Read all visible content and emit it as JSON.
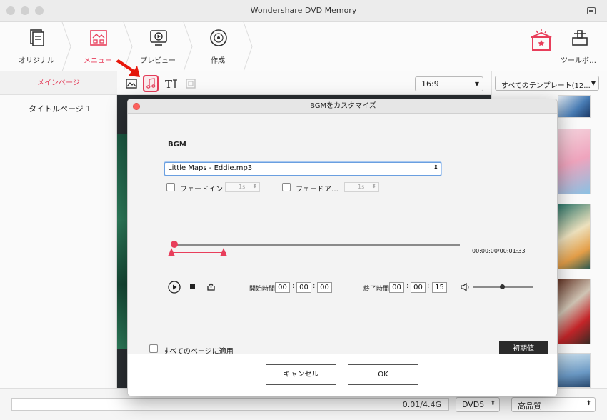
{
  "window": {
    "title": "Wondershare DVD Memory"
  },
  "steps": [
    {
      "label": "オリジナル"
    },
    {
      "label": "メニュー"
    },
    {
      "label": "プレビュー"
    },
    {
      "label": "作成"
    }
  ],
  "toolbox": {
    "label": "ツールボ…"
  },
  "sidebar": {
    "tab": "メインページ",
    "item": "タイトルページ 1"
  },
  "editbar": {
    "ratio": "16:9"
  },
  "templates": {
    "dropdown": "すべてのテンプレート(12..."
  },
  "status": {
    "capacity": "0.01/4.4G",
    "disc": "DVD5",
    "quality": "高品質"
  },
  "dialog": {
    "title": "BGMをカスタマイズ",
    "section": "BGM",
    "music_file": "Little Maps - Eddie.mp3",
    "fade_in_label": "フェードイン",
    "fade_in_value": "1s",
    "fade_out_label": "フェードア…",
    "fade_out_value": "1s",
    "time_readout": "00:00:00/00:01:33",
    "start_label": "開始時間",
    "start": [
      "00",
      "00",
      "00"
    ],
    "end_label": "終了時間",
    "end": [
      "00",
      "00",
      "15"
    ],
    "volume": 0.48,
    "apply_all_label": "すべてのページに適用",
    "reset_label": "初期値",
    "cancel_label": "キャンセル",
    "ok_label": "OK"
  },
  "colors": {
    "accent": "#e83e5b",
    "arrow": "#e8180c"
  }
}
